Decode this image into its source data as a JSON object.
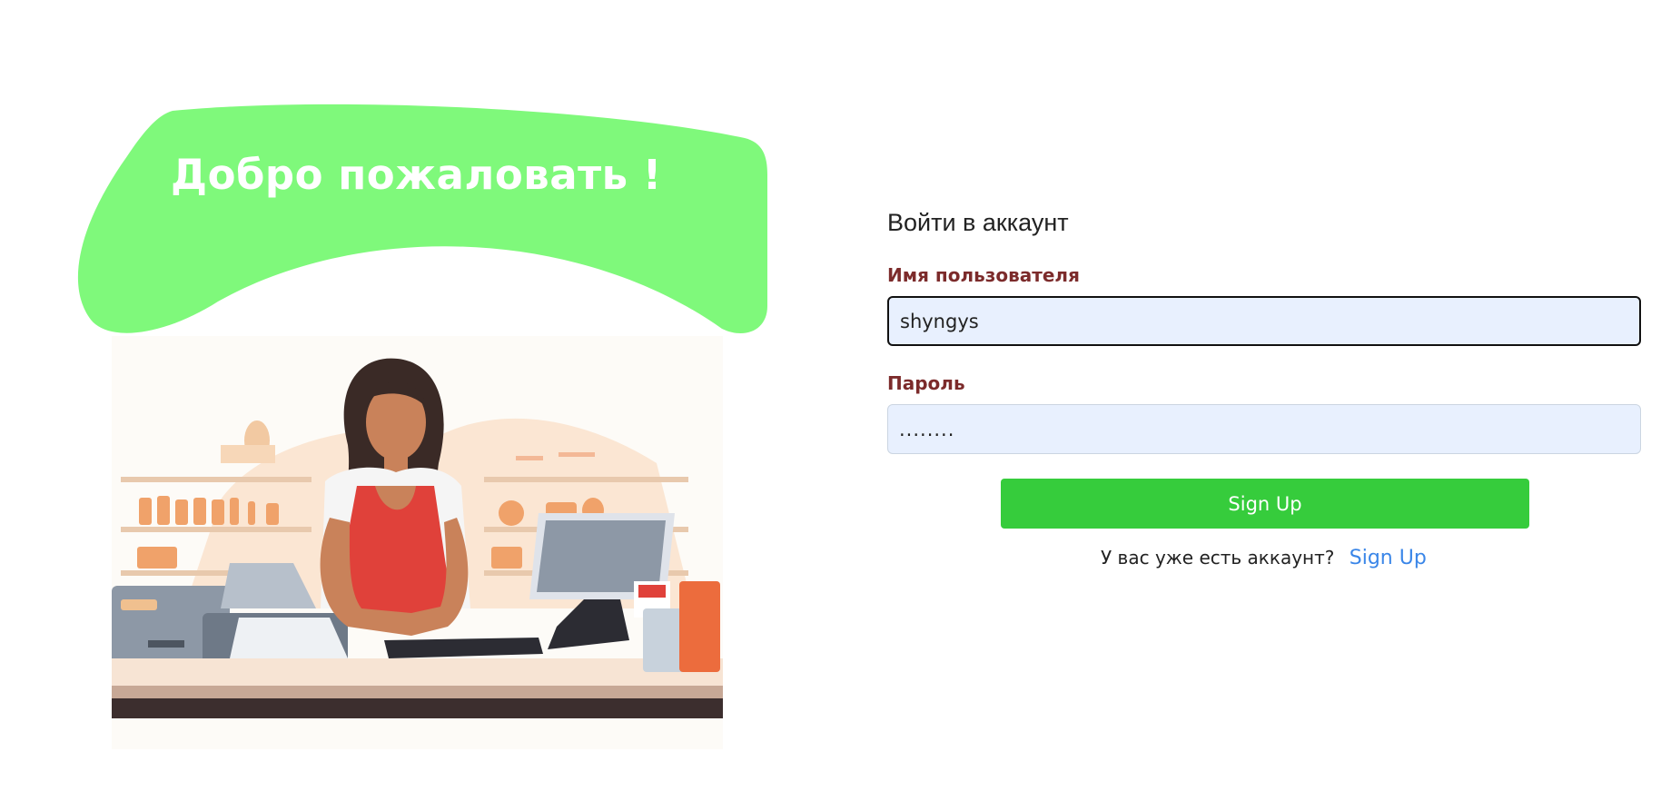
{
  "welcome": {
    "title": "Добро пожаловать !"
  },
  "form": {
    "title": "Войти в аккаунт",
    "username": {
      "label": "Имя пользователя",
      "value": "shyngys"
    },
    "password": {
      "label": "Пароль",
      "masked_value": "........"
    },
    "submit_label": "Sign Up",
    "account_prompt": "У вас уже есть аккаунт?",
    "account_link": "Sign Up"
  },
  "colors": {
    "blob": "#7ff97b",
    "submit": "#36cc3c",
    "label": "#7c2b2b",
    "link": "#3a86e8",
    "input_bg": "#e8f0fe"
  },
  "illustration": {
    "subject": "cashier-illustration"
  }
}
